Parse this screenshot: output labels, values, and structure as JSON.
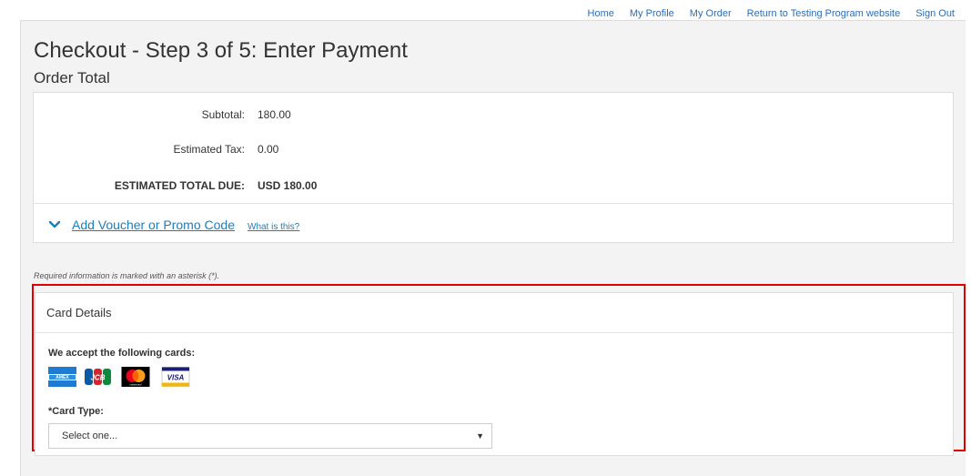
{
  "nav": {
    "links": [
      "Home",
      "My Profile",
      "My Order",
      "Return to Testing Program website",
      "Sign Out"
    ]
  },
  "page": {
    "title": "Checkout - Step 3 of 5: Enter Payment",
    "section_title": "Order Total"
  },
  "order": {
    "subtotal_label": "Subtotal:",
    "subtotal_value": "180.00",
    "tax_label": "Estimated Tax:",
    "tax_value": "0.00",
    "total_label": "ESTIMATED TOTAL DUE:",
    "total_value": "USD 180.00",
    "voucher_link": "Add Voucher or Promo Code",
    "whatis_link": "What is this?"
  },
  "required_note": "Required information is marked with an asterisk (*).",
  "card_details": {
    "heading": "Card Details",
    "accept_label": "We accept the following cards:",
    "cards": [
      "amex-card-icon",
      "jcb-card-icon",
      "mastercard-card-icon",
      "visa-card-icon"
    ],
    "card_type_label": "*Card Type:",
    "card_type_selected": "Select one..."
  },
  "colors": {
    "link": "#1b7fbf",
    "highlight_border": "#e00000",
    "panel_bg": "#f3f3f3"
  }
}
